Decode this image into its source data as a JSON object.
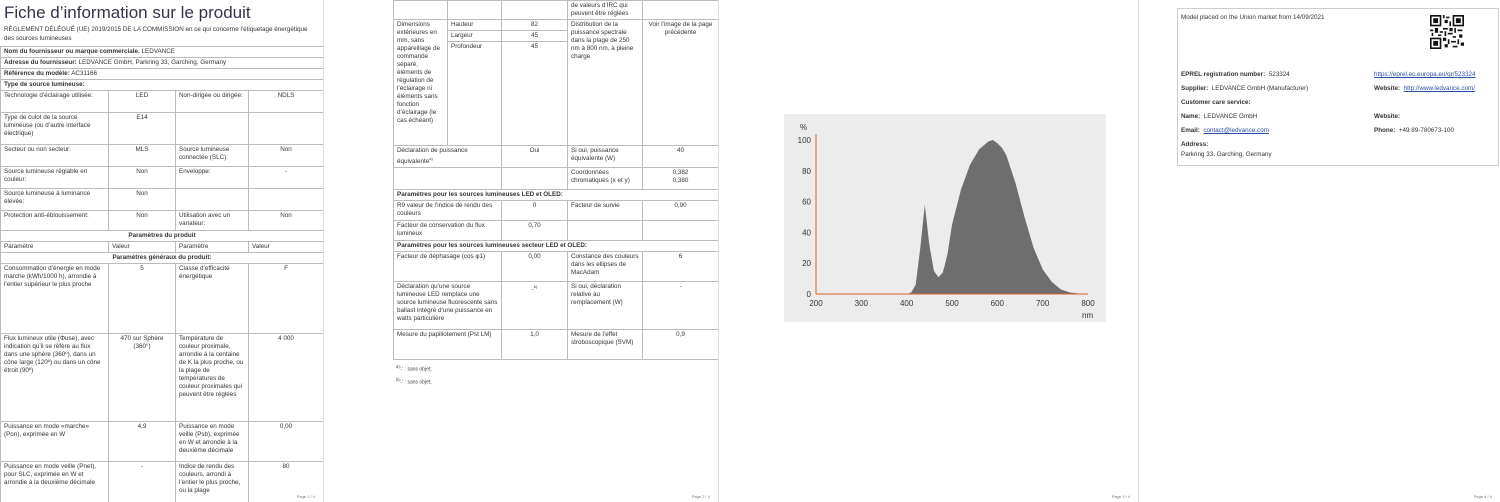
{
  "page1": {
    "title": "Fiche d’information sur le produit",
    "regulation": "RÈGLEMENT DÉLÉGUÉ (UE) 2019/2015 DE LA COMMISSION en ce qui concerne l'étiquetage énergétique des sources lumineuses",
    "supplier_label": "Nom du fournisseur ou marque commerciale.",
    "supplier_value": "LEDVANCE",
    "address_label": "Adresse du fournisseur:",
    "address_value": "LEDVANCE GmbH, Parkring 33, Garching, Germany",
    "model_label": "Référence du modèle:",
    "model_value": "AC31166",
    "type_heading": "Type de source lumineuse:",
    "rows_type": [
      {
        "l1": "Technologie d’éclairage utilisée:",
        "v1": "LED",
        "l2": "Non-dirigée ou dirigée:",
        "v2": "NDLS"
      },
      {
        "l1": "Type de culot de la source lumineuse (ou d’autre interface électrique)",
        "v1": "E14",
        "l2": "",
        "v2": ""
      },
      {
        "l1": "Secteur ou non secteur:",
        "v1": "MLS",
        "l2": "Source lumineuse connectée (SLC):",
        "v2": "Non"
      },
      {
        "l1": "Source lumineuse réglable en couleur:",
        "v1": "Non",
        "l2": "Enveloppe:",
        "v2": "-"
      },
      {
        "l1": "Source lumineuse à luminance élevée:",
        "v1": "Non",
        "l2": "",
        "v2": ""
      },
      {
        "l1": "Protection anti-éblouissement:",
        "v1": "Non",
        "l2": "Utilisation avec un variateur:",
        "v2": "Non"
      }
    ],
    "params_heading": "Paramètres du produit",
    "param_col": "Paramètre",
    "value_col": "Valeur",
    "general_heading": "Paramètres généraux du produit:",
    "rows_general": [
      {
        "l1": "Consommation d’énergie en mode marche (kWh/1000 h), arrondie à l’entier supérieur le plus proche",
        "v1": "5",
        "l2": "Classe d’efficacité énergétique",
        "v2": "F"
      },
      {
        "l1": "Flux lumineux utile (Φuse), avec indication qu’il se réfère au flux dans une sphère (360º), dans un cône large (120º) ou dans un cône étroit (90º)",
        "v1": "470 sur Sphère (360°)",
        "l2": "Température de couleur proximale, arrondie à la centaine de K la plus proche, ou la plage de températures de couleur proximales qui peuvent être réglées",
        "v2": "4 000"
      },
      {
        "l1": "Puissance en mode «marche» (Pon), exprimée en W",
        "v1": "4,9",
        "l2": "Puissance en mode veille (Psb), exprimée en W et arrondie à la deuxième décimale",
        "v2": "0,00"
      },
      {
        "l1": "Puissance en mode veille (Pnet), pour SLC, exprimée en W et arrondie à la deuxième décimale",
        "v1": "-",
        "l2": "Indice de rendu des couleurs, arrondi à l’entier le plus proche, ou la plage",
        "v2": "80"
      }
    ],
    "page_num": "Page 1 / 4"
  },
  "page2": {
    "cont_text": "de valeurs d’IRC qui peuvent être réglées",
    "dim_label": "Dimensions extérieures en mm, sans appareillage de commande séparé, éléments de régulation de l’éclairage ni éléments sans fonction d’éclairage (le cas échéant)",
    "dims": [
      {
        "name": "Hauteur",
        "value": "82"
      },
      {
        "name": "Largeur",
        "value": "45"
      },
      {
        "name": "Profondeur",
        "value": "45"
      }
    ],
    "spectral_label": "Distribution de la puissance spectrale dans la plage de 250 nm à 800 nm, à pleine charge",
    "spectral_value": "Voir l’image de la page précédente",
    "equiv_label": "Déclaration de puissance équivalente",
    "equiv_sup": "a)",
    "equiv_value": "Oui",
    "equiv_w_label": "Si oui, puissance équivalente (W)",
    "equiv_w_value": "40",
    "chroma_label": "Coordonnées chromatiques (x et y)",
    "chroma_x": "0,382",
    "chroma_y": "0,380",
    "led_heading": "Paramètres pour les sources lumineuses LED et OLED:",
    "r9_label": "R9 valeur de l’indice de rendu des couleurs",
    "r9_value": "0",
    "survival_label": "Facteur de survie",
    "survival_value": "0,90",
    "flux_label": "Facteur de conservation du flux lumineux",
    "flux_value": "0,70",
    "mains_heading": "Paramètres pour les sources lumineuses secteur LED et OLED:",
    "phase_label": "Facteur de déphasage (cos φ1)",
    "phase_value": "0,00",
    "macadam_label": "Constance des couleurs dans les ellipses de MacAdam",
    "macadam_value": "6",
    "replace_label": "Déclaration qu’une source lumineuse LED remplace une source lumineuse fluorescente sans ballast intégré d’une puissance en watts particulière",
    "replace_value": "-",
    "replace_sup": "b)",
    "replace_w_label": "Si oui, déclaration relative au remplacement (W)",
    "replace_w_value": "-",
    "flicker_label": "Mesure du papillotement (Pst LM)",
    "flicker_value": "1,0",
    "strobo_label": "Mesure de l’effet stroboscopique (SVM)",
    "strobo_value": "0,9",
    "note_a_mark": "a)",
    "note_a": "'-' : sans objet;",
    "note_b_mark": "b)",
    "note_b": "'-' : sans objet;",
    "page_num": "Page 2 / 4"
  },
  "page3": {
    "page_num": "Page 3 / 4",
    "chart_data": {
      "type": "area",
      "ylabel": "%",
      "xlabel": "nm",
      "xlim": [
        200,
        800
      ],
      "ylim": [
        0,
        100
      ],
      "xticks": [
        200,
        300,
        400,
        500,
        600,
        700,
        800
      ],
      "yticks": [
        0,
        20,
        40,
        60,
        80,
        100
      ],
      "x": [
        400,
        410,
        420,
        430,
        440,
        450,
        460,
        470,
        480,
        490,
        500,
        520,
        540,
        560,
        580,
        590,
        600,
        610,
        620,
        640,
        660,
        680,
        700,
        720,
        740,
        760,
        780,
        800
      ],
      "values": [
        0,
        1,
        6,
        30,
        58,
        32,
        15,
        11,
        14,
        26,
        45,
        68,
        84,
        94,
        99,
        100,
        98,
        95,
        90,
        72,
        50,
        30,
        16,
        8,
        3,
        1,
        0.3,
        0
      ],
      "fill_color": "#6e6e6e",
      "axis_color": "#e06030"
    }
  },
  "page4": {
    "placed_text": "Model placed on the Union market from 14/09/2021",
    "eprel_label": "EPREL registration number:",
    "eprel_value": "523324",
    "eprel_url": "https://eprel.ec.europa.eu/qr/523324",
    "supplier_label": "Supplier:",
    "supplier_value": "LEDVANCE GmbH (Manufacturer)",
    "website_label": "Website:",
    "website_url": "http://www.ledvance.com/",
    "customer_heading": "Customer care service:",
    "name_label": "Name:",
    "name_value": "LEDVANCE GmbH",
    "website2_label": "Website:",
    "email_label": "Email:",
    "email_value": "contact@ledvance.com",
    "phone_label": "Phone:",
    "phone_value": "+49 89-780673-100",
    "address_label": "Address:",
    "address_value": "Parkring 33, Garching, Germany",
    "page_num": "Page 4 / 4",
    "qr_icon": "qr-code-icon"
  }
}
